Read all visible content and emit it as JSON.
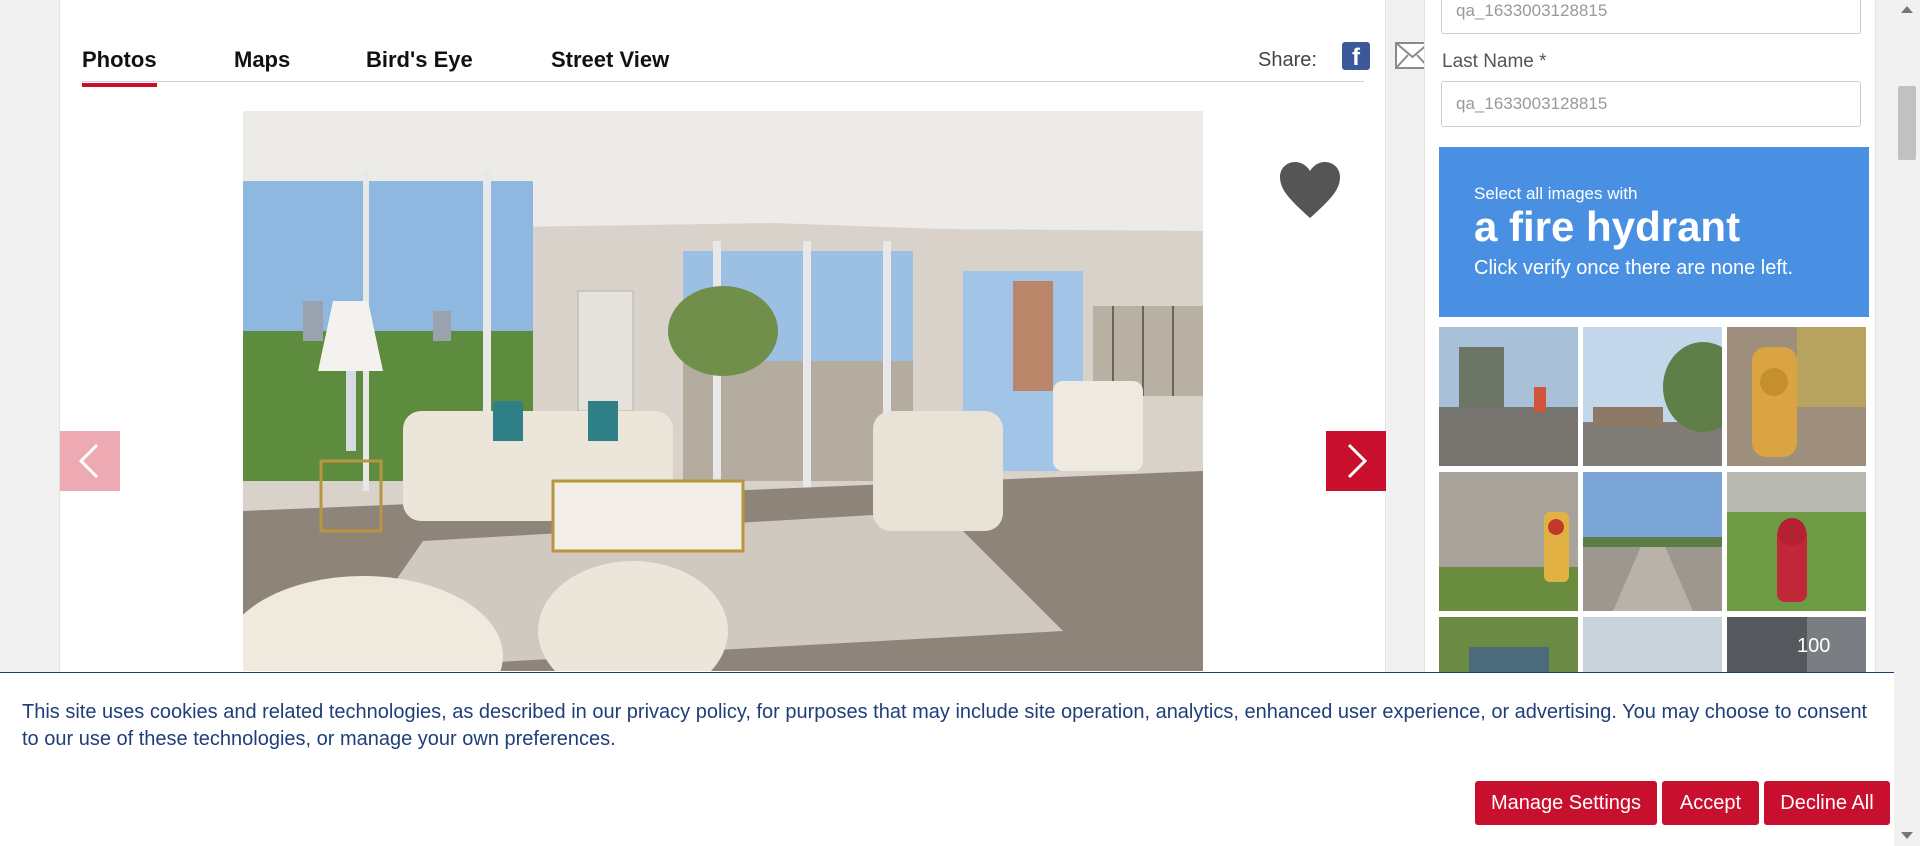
{
  "tabs": [
    {
      "label": "Photos",
      "active": true
    },
    {
      "label": "Maps",
      "active": false
    },
    {
      "label": "Bird's Eye",
      "active": false
    },
    {
      "label": "Street View",
      "active": false
    }
  ],
  "share": {
    "label": "Share:",
    "facebook_icon": "facebook-icon",
    "email_icon": "email-icon"
  },
  "gallery": {
    "favorite_icon": "heart-icon",
    "prev_icon": "chevron-left-icon",
    "next_icon": "chevron-right-icon"
  },
  "form": {
    "first_name_value": "qa_1633003128815",
    "last_name_label": "Last Name *",
    "last_name_value": "qa_1633003128815"
  },
  "captcha": {
    "instruction": "Select all images with",
    "target": "a fire hydrant",
    "subtext": "Click verify once there are none left.",
    "tile_label": "100"
  },
  "cookie_banner": {
    "text": "This site uses cookies and related technologies, as described in our privacy policy, for purposes that may include site operation, analytics, enhanced user experience, or advertising. You may choose to consent to our use of these technologies, or manage your own preferences.",
    "manage_label": "Manage Settings",
    "accept_label": "Accept",
    "decline_label": "Decline All"
  },
  "colors": {
    "accent": "#c8102e",
    "captcha_blue": "#4a90e2",
    "banner_text": "#1f3e7a"
  }
}
